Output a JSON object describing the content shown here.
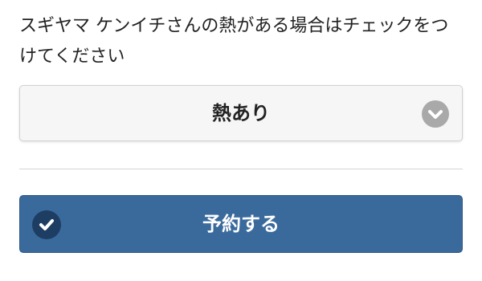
{
  "question": {
    "text": "スギヤマ ケンイチさんの熱がある場合はチェックをつけてください"
  },
  "fever_select": {
    "selected_label": "熱あり",
    "icon": "chevron-down-circle-icon"
  },
  "reserve_button": {
    "label": "予約する",
    "icon": "check-circle-icon"
  },
  "colors": {
    "primary_button": "#3a6a9c",
    "button_icon_bg": "#1d3d63",
    "select_bg": "#f6f6f6",
    "chevron_bg": "#a9a9a9",
    "text": "#222222"
  }
}
